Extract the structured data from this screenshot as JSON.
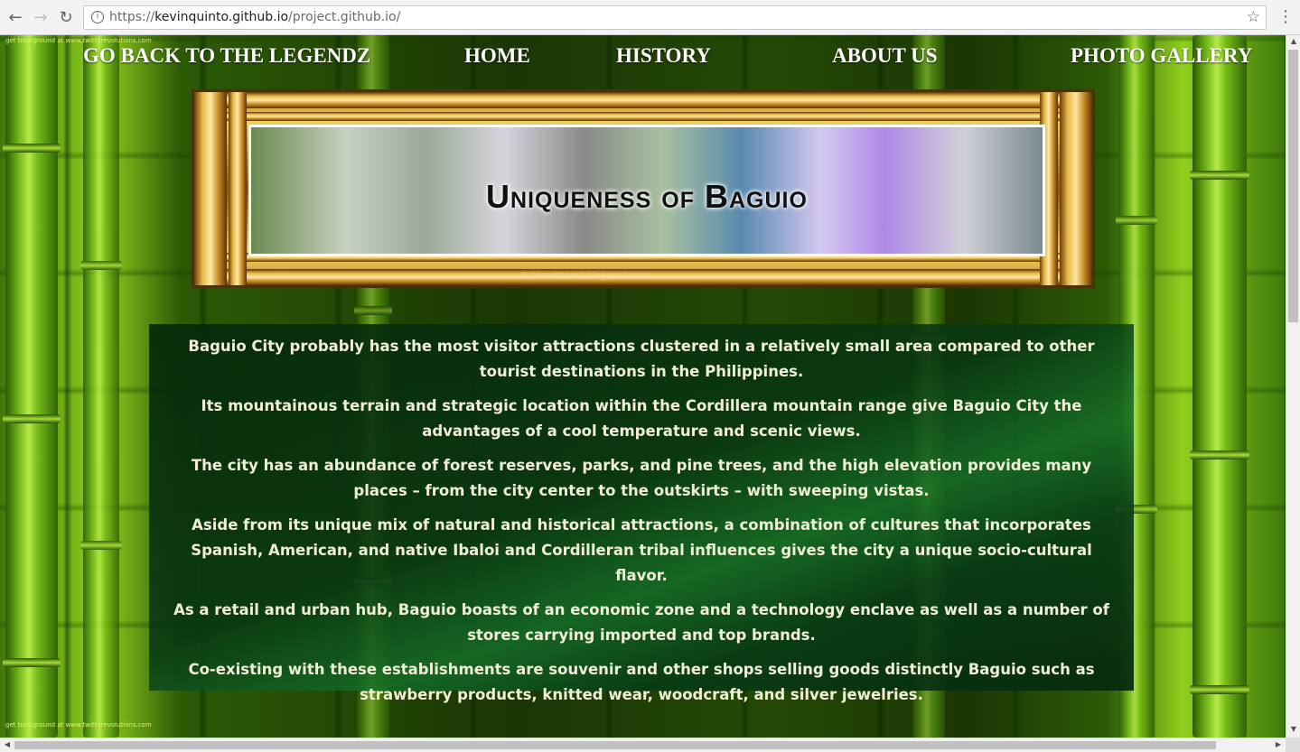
{
  "browser": {
    "url_scheme": "https://",
    "url_host": "kevinquinto.github.io",
    "url_path": "/project.github.io/",
    "back_icon": "←",
    "forward_icon": "→",
    "reload_icon": "↻",
    "info_icon": "i",
    "star_icon": "☆",
    "menu_icon": "⋮"
  },
  "page": {
    "credit_top": "get background at www.twitterevolutions.com",
    "credit_bottom": "get background at www.twitterevolutions.com",
    "nav": {
      "back_link": "GO BACK TO THE LEGENDZ",
      "home": "HOME",
      "history": "HISTORY",
      "about": "ABOUT US",
      "gallery": "PHOTO GALLERY"
    },
    "banner": {
      "title": "Uniqueness of Baguio",
      "watermark": "© blendztodol.blogspot.com"
    },
    "paragraphs": [
      "Baguio City probably has the most visitor attractions clustered in a relatively small area compared to other tourist destinations in the Philippines.",
      "Its mountainous terrain and strategic location within the Cordillera mountain range give Baguio City the advantages of a cool temperature and scenic views.",
      "The city has an abundance of forest reserves, parks, and pine trees, and the high elevation provides many places – from the city center to the outskirts – with sweeping vistas.",
      "Aside from its unique mix of natural and historical attractions, a combination of cultures that incorporates Spanish, American, and native Ibaloi and Cordilleran tribal influences gives the city a unique socio-cultural flavor.",
      "As a retail and urban hub, Baguio boasts of an economic zone and a technology enclave as well as a number of stores carrying imported and top brands.",
      "Co-existing with these establishments are souvenir and other shops selling goods distinctly Baguio such as strawberry products, knitted wear, woodcraft, and silver jewelries."
    ]
  }
}
